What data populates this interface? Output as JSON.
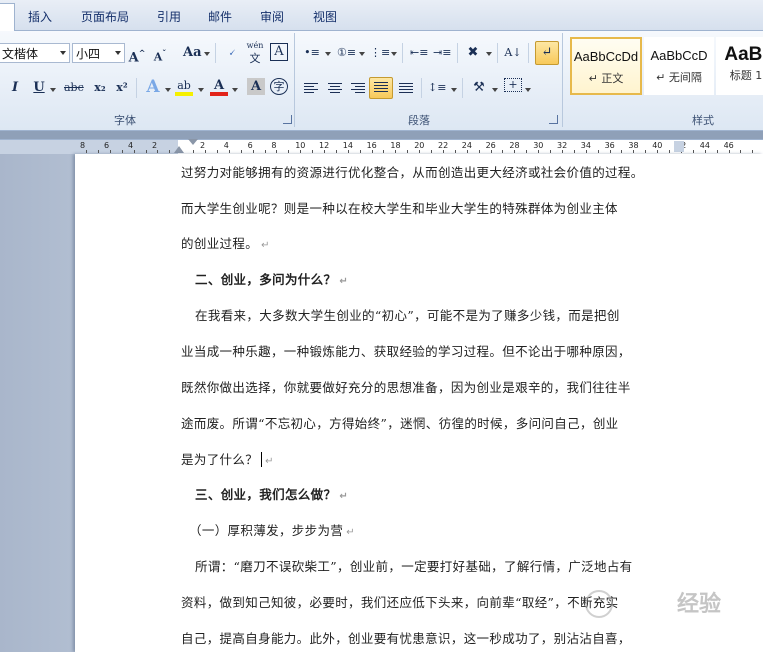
{
  "tabs": {
    "insert": "插入",
    "page_layout": "页面布局",
    "references": "引用",
    "mailings": "邮件",
    "review": "审阅",
    "view": "视图"
  },
  "font_group": {
    "font_name": "文楷体",
    "font_size": "小四",
    "grow_font": "A",
    "shrink_font": "A",
    "change_case": "Aa",
    "phonetic": "文",
    "char_border": "A",
    "italic": "I",
    "underline": "U",
    "strikethrough": "abc",
    "subscript": "x₂",
    "superscript": "x²",
    "text_effect": "A",
    "highlight": "ab",
    "font_color": "A",
    "char_shading": "A",
    "enclose_char": "字",
    "label": "字体"
  },
  "paragraph_group": {
    "label": "段落",
    "show_marks": "↵"
  },
  "styles_group": {
    "label": "样式",
    "items": [
      {
        "sample": "AaBbCcDd",
        "name": "↵ 正文"
      },
      {
        "sample": "AaBbCcD",
        "name": "↵ 无间隔"
      },
      {
        "sample": "AaBl",
        "name": "标题 1"
      }
    ]
  },
  "ruler": {
    "left_numbers": [
      "8",
      "6",
      "4",
      "2"
    ],
    "right_numbers": [
      "2",
      "4",
      "6",
      "8",
      "10",
      "12",
      "14",
      "16",
      "18",
      "20",
      "22",
      "24",
      "26",
      "28",
      "30",
      "32",
      "34",
      "36",
      "38",
      "40",
      "42",
      "44",
      "46"
    ]
  },
  "document": {
    "lines": [
      {
        "text": "过努力对能够拥有的资源进行优化整合，从而创造出更大经济或社会价值的过程。",
        "mark": ""
      },
      {
        "text": "而大学生创业呢？则是一种以在校大学生和毕业大学生的特殊群体为创业主体",
        "mark": ""
      },
      {
        "text": "的创业过程。",
        "mark": "↵"
      },
      {
        "text": "二、创业，多问为什么？",
        "mark": "↵"
      },
      {
        "text": "在我看来，大多数大学生创业的“初心”，可能不是为了赚多少钱，而是把创",
        "mark": ""
      },
      {
        "text": "业当成一种乐趣，一种锻炼能力、获取经验的学习过程。但不论出于哪种原因，",
        "mark": ""
      },
      {
        "text": "既然你做出选择，你就要做好充分的思想准备，因为创业是艰辛的，我们往往半",
        "mark": ""
      },
      {
        "text": "途而废。所谓“不忘初心，方得始终”，迷惘、彷徨的时候，多问问自己，创业",
        "mark": ""
      },
      {
        "text": "是为了什么？",
        "mark": "↵"
      },
      {
        "text": "三、创业，我们怎么做？",
        "mark": "↵"
      },
      {
        "text": "（一）厚积薄发，步步为营",
        "mark": "↵"
      },
      {
        "text": "所谓：“磨刀不误砍柴工”，创业前，一定要打好基础，了解行情，广泛地占有",
        "mark": ""
      },
      {
        "text": "资料，做到知己知彼，必要时，我们还应低下头来，向前辈“取经”，不断充实",
        "mark": ""
      },
      {
        "text": "自己，提高自身能力。此外，创业要有忧患意识，这一秒成功了，别沾沾自喜，",
        "mark": ""
      }
    ]
  },
  "watermark": "经验"
}
